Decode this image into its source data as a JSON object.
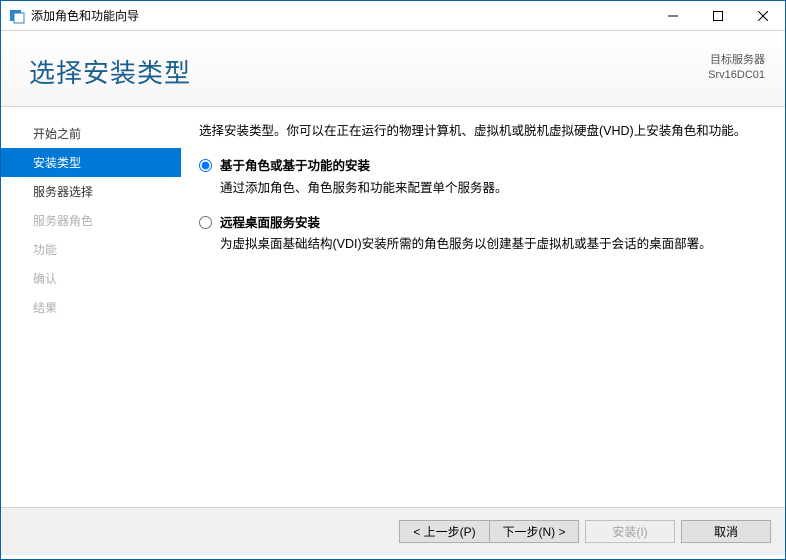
{
  "window": {
    "title": "添加角色和功能向导"
  },
  "header": {
    "heading": "选择安装类型",
    "target_label": "目标服务器",
    "target_server": "Srv16DC01"
  },
  "sidebar": {
    "steps": [
      {
        "label": "开始之前",
        "state": "done"
      },
      {
        "label": "安装类型",
        "state": "current"
      },
      {
        "label": "服务器选择",
        "state": "next"
      },
      {
        "label": "服务器角色",
        "state": "disabled"
      },
      {
        "label": "功能",
        "state": "disabled"
      },
      {
        "label": "确认",
        "state": "disabled"
      },
      {
        "label": "结果",
        "state": "disabled"
      }
    ]
  },
  "content": {
    "intro": "选择安装类型。你可以在正在运行的物理计算机、虚拟机或脱机虚拟硬盘(VHD)上安装角色和功能。",
    "options": [
      {
        "title": "基于角色或基于功能的安装",
        "desc": "通过添加角色、角色服务和功能来配置单个服务器。",
        "selected": true
      },
      {
        "title": "远程桌面服务安装",
        "desc": "为虚拟桌面基础结构(VDI)安装所需的角色服务以创建基于虚拟机或基于会话的桌面部署。",
        "selected": false
      }
    ]
  },
  "footer": {
    "prev": "< 上一步(P)",
    "next": "下一步(N) >",
    "install": "安装(I)",
    "cancel": "取消"
  }
}
